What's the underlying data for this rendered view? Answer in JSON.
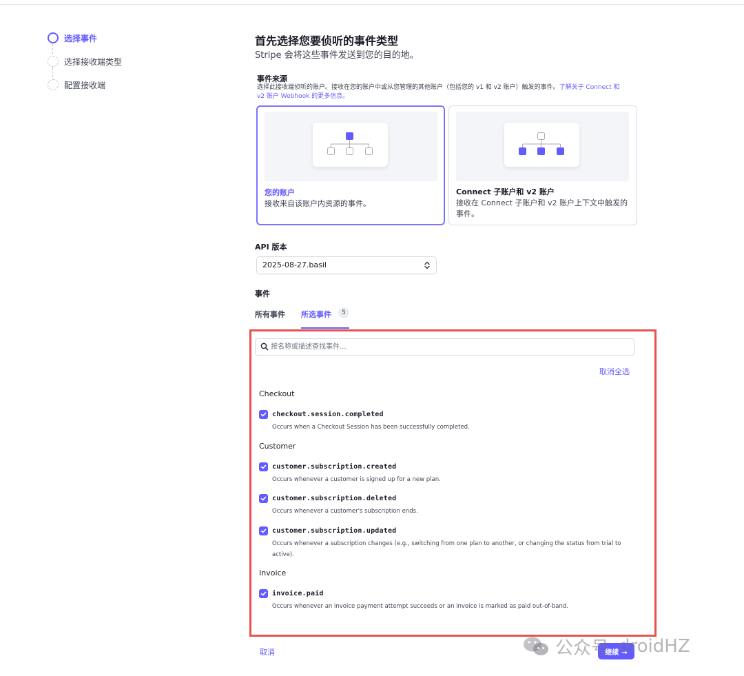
{
  "steps": [
    {
      "label": "选择事件"
    },
    {
      "label": "选择接收端类型"
    },
    {
      "label": "配置接收端"
    }
  ],
  "header": {
    "title": "首先选择您要侦听的事件类型",
    "subtitle": "Stripe 会将这些事件发送到您的目的地。"
  },
  "event_source": {
    "title": "事件来源",
    "description": "选择此接收端侦听的账户。接收在您的账户中或从您管理的其他账户（包括您的 v1 和 v2 账户）触发的事件。",
    "link_text": "了解关于 Connect 和 v2 账户 Webhook 的更多信息。",
    "cards": [
      {
        "title": "您的账户",
        "description": "接收来自该账户内资源的事件。"
      },
      {
        "title": "Connect 子账户和 v2 账户",
        "description": "接收在 Connect 子账户和 v2 账户上下文中触发的事件。"
      }
    ]
  },
  "api_version": {
    "label": "API 版本",
    "value": "2025-08-27.basil"
  },
  "events": {
    "label": "事件",
    "tabs": [
      {
        "label": "所有事件"
      },
      {
        "label": "所选事件",
        "count": "5"
      }
    ],
    "search_placeholder": "按名称或描述查找事件...",
    "deselect_all": "取消全选",
    "groups": [
      {
        "title": "Checkout",
        "items": [
          {
            "name": "checkout.session.completed",
            "description": "Occurs when a Checkout Session has been successfully completed."
          }
        ]
      },
      {
        "title": "Customer",
        "items": [
          {
            "name": "customer.subscription.created",
            "description": "Occurs whenever a customer is signed up for a new plan."
          },
          {
            "name": "customer.subscription.deleted",
            "description": "Occurs whenever a customer's subscription ends."
          },
          {
            "name": "customer.subscription.updated",
            "description": "Occurs whenever a subscription changes (e.g., switching from one plan to another, or changing the status from trial to active)."
          }
        ]
      },
      {
        "title": "Invoice",
        "items": [
          {
            "name": "invoice.paid",
            "description": "Occurs whenever an invoice payment attempt succeeds or an invoice is marked as paid out-of-band."
          }
        ]
      }
    ]
  },
  "footer": {
    "cancel": "取消",
    "continue": "继续"
  },
  "watermark": {
    "label": "公众号",
    "name": "droidHZ"
  },
  "colors": {
    "accent": "#635bff",
    "highlight_border": "#e5534b"
  }
}
